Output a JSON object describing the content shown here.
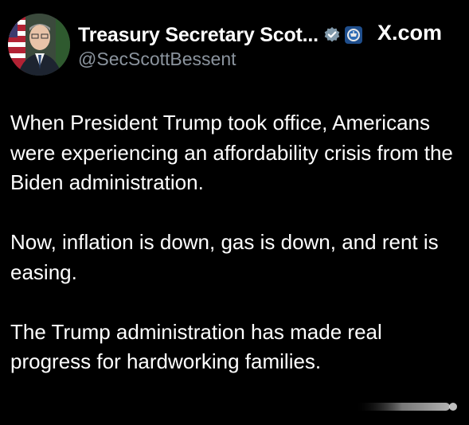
{
  "author": {
    "display_name": "Treasury Secretary Scot...",
    "handle": "@SecScottBessent",
    "avatar_icon": "avatar-portrait",
    "verified_icon": "gray-verified-badge",
    "affiliation_icon": "treasury-seal-badge"
  },
  "brand": {
    "label": "X.com"
  },
  "tweet": {
    "paragraphs": [
      "When President Trump took office, Americans were experiencing an affordability crisis from the Biden administration.",
      "Now, inflation is down, gas is down, and rent is easing.",
      "The Trump administration has made real progress for hardworking families."
    ]
  },
  "colors": {
    "background": "#000000",
    "text": "#ffffff",
    "handle": "#8b949e",
    "verified_badge": "#829aab"
  }
}
